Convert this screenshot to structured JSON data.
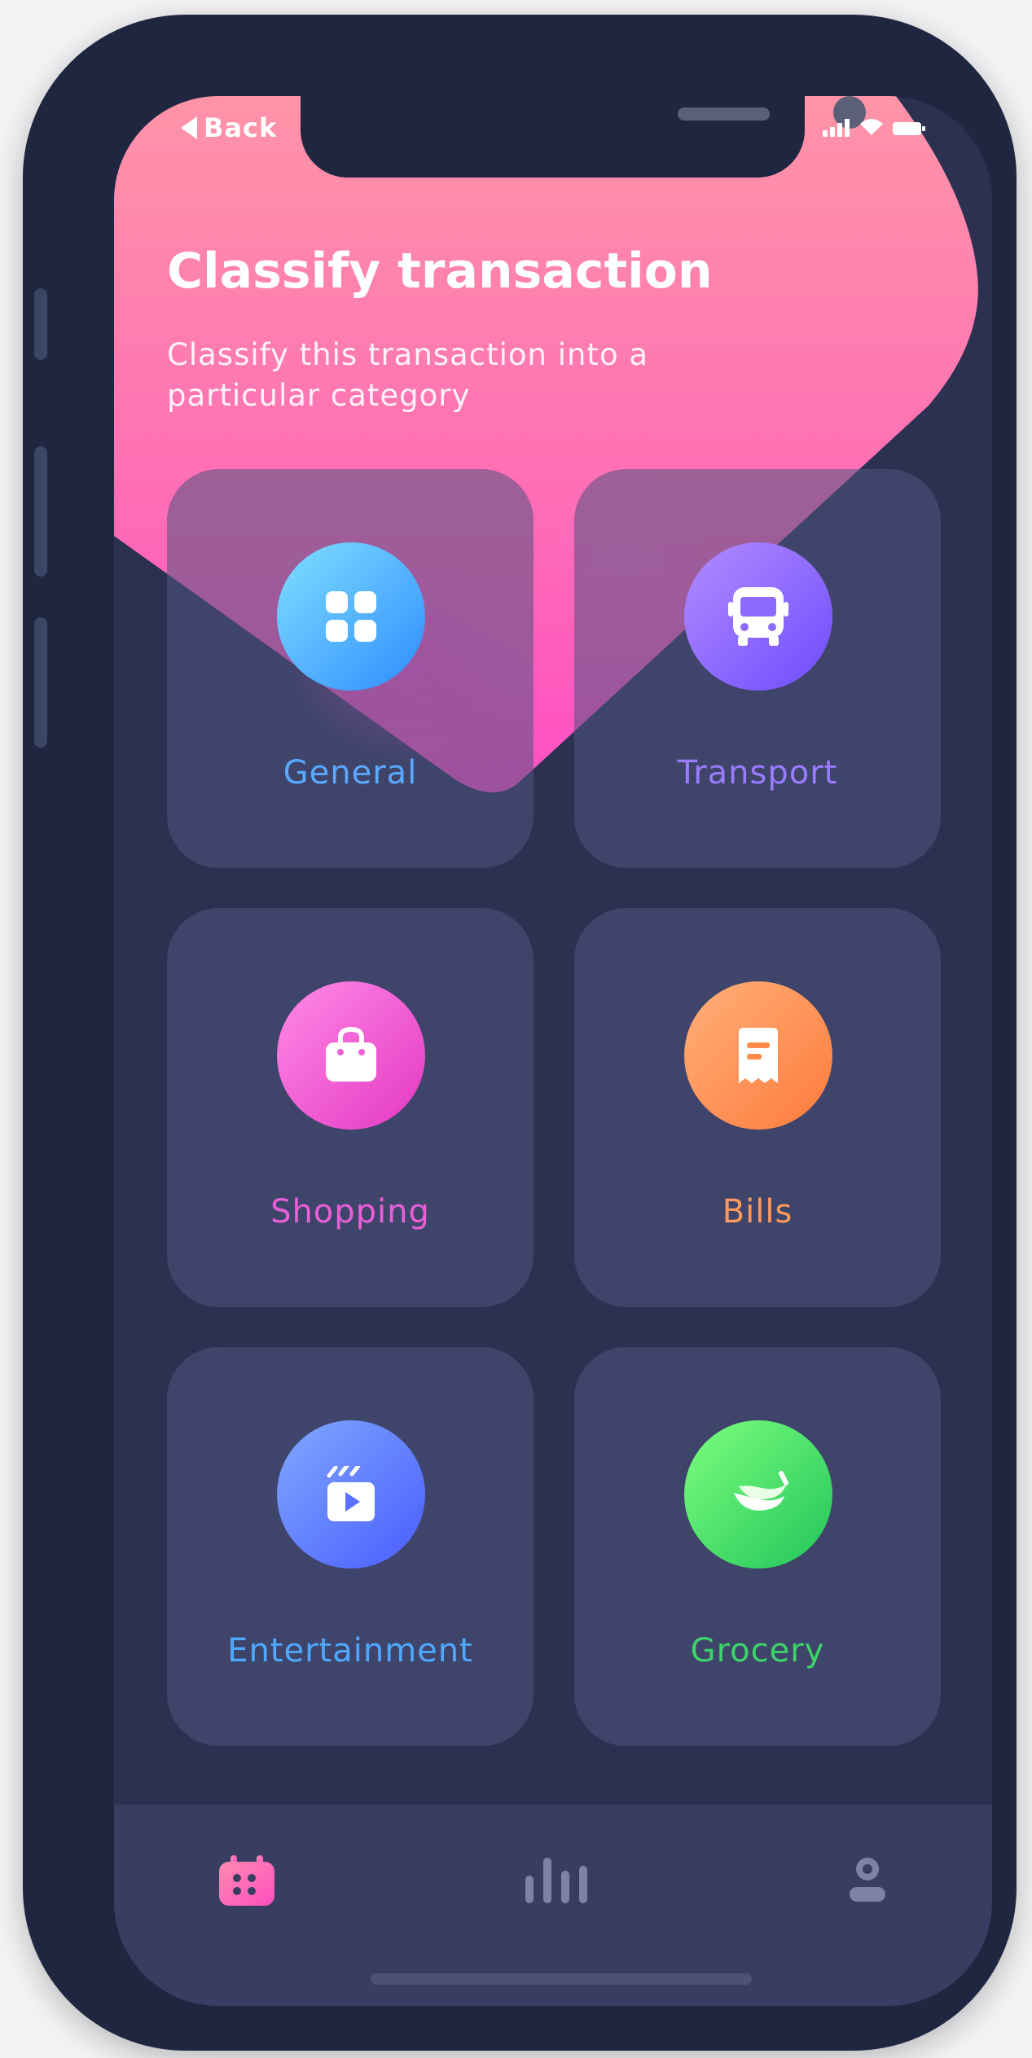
{
  "colors": {
    "phone_frame": "#1f2640",
    "screen_bg": "#2d3151",
    "header_pink": "#ff6fb0",
    "tabbar_bg": "#383d62",
    "active_tab": "#ff6fae",
    "inactive_tab": "#7d83a6"
  },
  "status_bar": {
    "back_label": "Back",
    "icons": [
      "signal-icon",
      "wifi-icon",
      "battery-icon"
    ]
  },
  "header": {
    "title": "Classify transaction",
    "subtitle": "Classify this transaction into a particular category"
  },
  "categories": [
    {
      "label": "General",
      "icon": "grid-icon",
      "color": "#58a9ff"
    },
    {
      "label": "Transport",
      "icon": "bus-icon",
      "color": "#9b7bff"
    },
    {
      "label": "Shopping",
      "icon": "shopping-bag-icon",
      "color": "#e95fd8"
    },
    {
      "label": "Bills",
      "icon": "receipt-icon",
      "color": "#ff9a5c"
    },
    {
      "label": "Entertainment",
      "icon": "clapperboard-icon",
      "color": "#4fa8ff"
    },
    {
      "label": "Grocery",
      "icon": "banana-icon",
      "color": "#3dd46a"
    }
  ],
  "tab_bar": {
    "tabs": [
      {
        "icon": "calendar-icon",
        "active": true
      },
      {
        "icon": "stats-icon",
        "active": false
      },
      {
        "icon": "profile-icon",
        "active": false
      }
    ]
  }
}
